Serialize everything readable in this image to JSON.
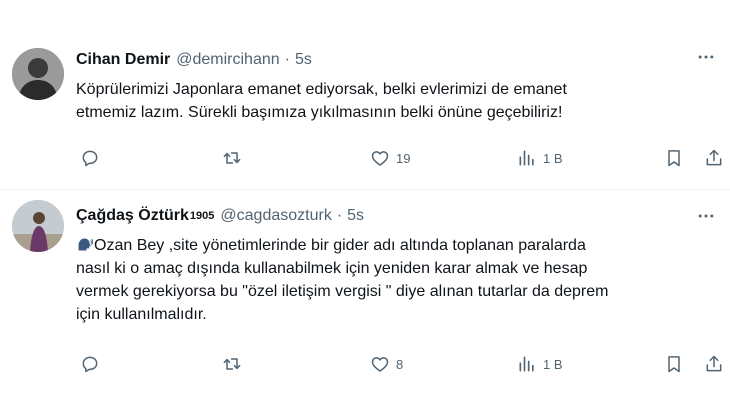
{
  "tweets": [
    {
      "author": "Cihan Demir",
      "handle": "@demircihann",
      "time": "5s",
      "text_lines": [
        "Köprülerimizi Japonlara emanet ediyorsak, belki evlerimizi de emanet",
        "etmemiz lazım. Sürekli başımıza yıkılmasının belki önüne geçebiliriz!"
      ],
      "likes": "19",
      "views": "1 B"
    },
    {
      "author": "Çağdaş Öztürk",
      "author_sup": "1905",
      "handle": "@cagdasozturk",
      "time": "5s",
      "text_lines": [
        "Ozan Bey ,site yönetimlerinde bir gider adı altında toplanan paralarda",
        "nasıl ki o amaç dışında kullanabilmek için yeniden karar almak ve hesap",
        "vermek gerekiyorsa bu \"özel iletişim vergisi \" diye alınan tutarlar da deprem",
        "için kullanılmalıdır."
      ],
      "likes": "8",
      "views": "1 B"
    }
  ],
  "icons": {
    "reply": "reply-icon",
    "retweet": "retweet-icon",
    "like": "heart-icon",
    "views": "views-icon",
    "bookmark": "bookmark-icon",
    "share": "share-icon",
    "more": "more-icon",
    "emoji": "speaking-head-emoji-icon"
  },
  "colors": {
    "text": "#0f1419",
    "secondary": "#536471",
    "divider": "#eff3f4"
  }
}
